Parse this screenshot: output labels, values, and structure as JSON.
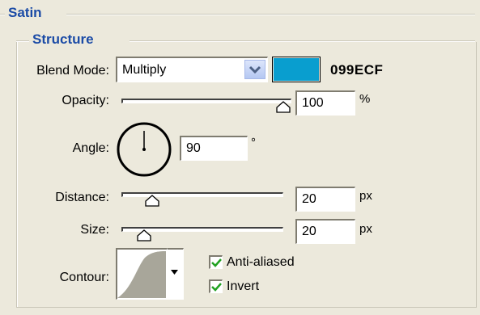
{
  "panel": {
    "title": "Satin",
    "section_title": "Structure"
  },
  "blend_mode": {
    "label": "Blend Mode:",
    "value": "Multiply",
    "color_hex": "099ECF",
    "swatch_color": "#099ECF"
  },
  "opacity": {
    "label": "Opacity:",
    "value": "100",
    "unit": "%",
    "slider_fraction": 1.0
  },
  "angle": {
    "label": "Angle:",
    "value": "90",
    "unit": "°"
  },
  "distance": {
    "label": "Distance:",
    "value": "20",
    "unit": "px"
  },
  "size": {
    "label": "Size:",
    "value": "20",
    "unit": "px"
  },
  "contour": {
    "label": "Contour:",
    "anti_aliased_label": "Anti-aliased",
    "anti_aliased_checked": true,
    "invert_label": "Invert",
    "invert_checked": true
  },
  "icons": {
    "dropdown": "chevron-down-icon",
    "contour_dropdown": "triangle-down-icon",
    "checkmark": "checkmark-icon"
  }
}
